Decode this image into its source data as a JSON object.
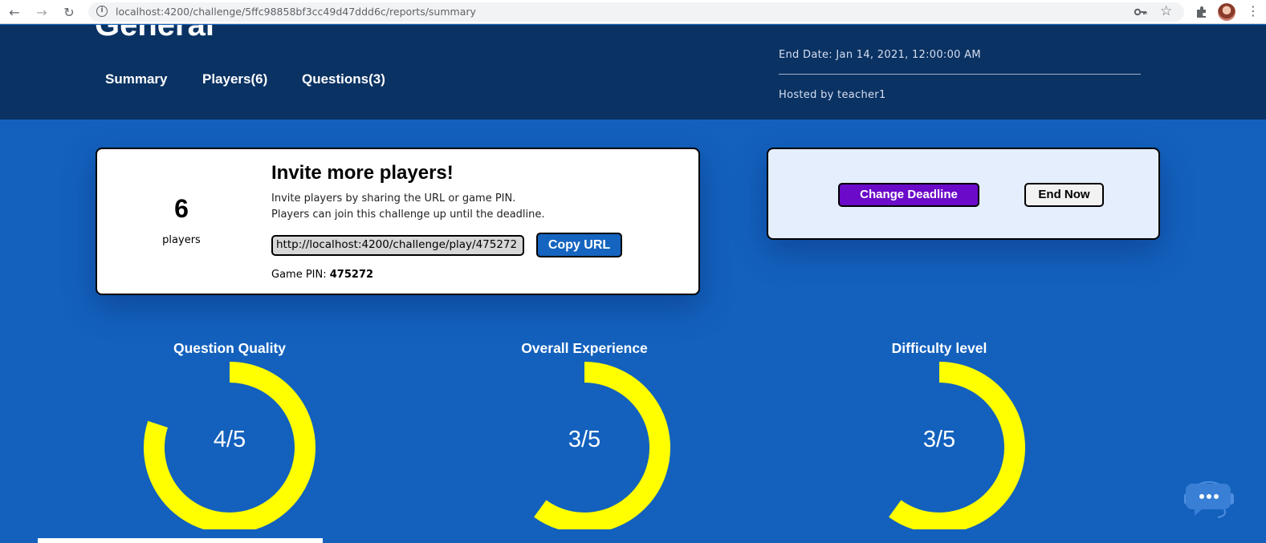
{
  "browser": {
    "url": "localhost:4200/challenge/5ffc98858bf3cc49d47ddd6c/reports/summary"
  },
  "header": {
    "title": "General",
    "tabs": [
      {
        "label": "Summary"
      },
      {
        "label": "Players(6)"
      },
      {
        "label": "Questions(3)"
      }
    ],
    "end_date": "End Date: Jan 14, 2021, 12:00:00 AM",
    "hosted_by": "Hosted by teacher1"
  },
  "invite": {
    "player_count": "6",
    "player_label": "players",
    "title": "Invite more players!",
    "desc_line1": "Invite players by sharing the URL or game PIN.",
    "desc_line2": "Players can join this challenge up until the deadline.",
    "url_value": "http://localhost:4200/challenge/play/475272",
    "copy_label": "Copy URL",
    "pin_label": "Game PIN:",
    "pin_value": "475272"
  },
  "actions": {
    "change_deadline_label": "Change Deadline",
    "end_now_label": "End Now"
  },
  "ratings": [
    {
      "title": "Question Quality",
      "value_text": "4/5",
      "value": 4,
      "max": 5
    },
    {
      "title": "Overall Experience",
      "value_text": "3/5",
      "value": 3,
      "max": 5
    },
    {
      "title": "Difficulty level",
      "value_text": "3/5",
      "value": 3,
      "max": 5
    }
  ],
  "colors": {
    "header_bg": "#0a3263",
    "page_bg": "#1361bd",
    "ring": "#ffff00",
    "primary_button": "#1565c0",
    "deadline_button": "#6b0ac9"
  },
  "icons": {
    "chat": "chatbot-icon",
    "back": "arrow-left-icon",
    "forward": "arrow-right-icon",
    "reload": "reload-icon"
  }
}
